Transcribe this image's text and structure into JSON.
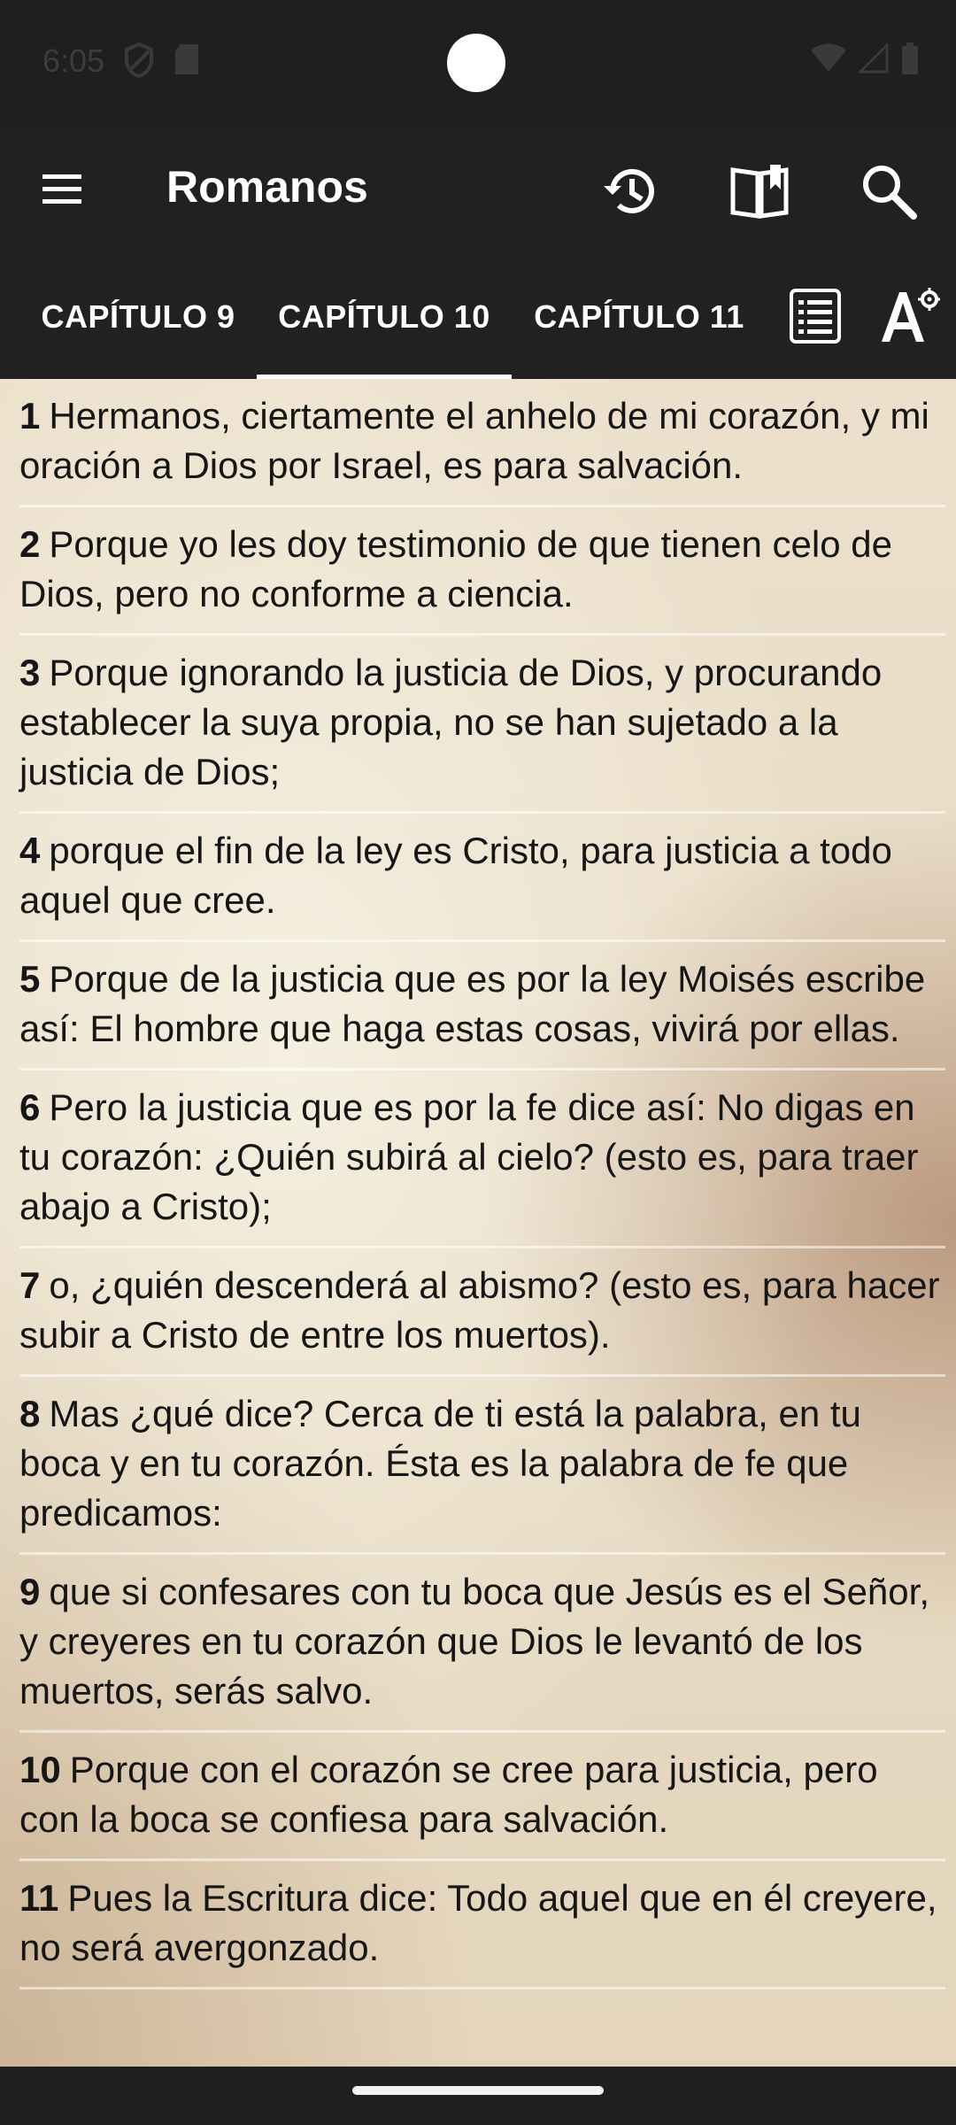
{
  "status_bar": {
    "time": "6:05",
    "icons": [
      "shield-icon",
      "sd-card-icon",
      "wifi-icon",
      "signal-icon",
      "battery-icon"
    ]
  },
  "toolbar": {
    "title": "Romanos",
    "icons": [
      "menu-icon",
      "history-icon",
      "book-icon",
      "search-icon"
    ]
  },
  "tabs": [
    {
      "label": "CAPÍTULO 9",
      "active": false
    },
    {
      "label": "CAPÍTULO 10",
      "active": true
    },
    {
      "label": "CAPÍTULO 11",
      "active": false
    }
  ],
  "tab_actions": [
    "list-icon",
    "font-settings-icon"
  ],
  "verses": [
    {
      "num": "1",
      "text": "Hermanos, ciertamente el anhelo de mi corazón, y mi oración a Dios por Israel, es para salvación."
    },
    {
      "num": "2",
      "text": "Porque yo les doy testimonio de que tienen celo de Dios, pero no conforme a ciencia."
    },
    {
      "num": "3",
      "text": "Porque ignorando la justicia de Dios, y procurando establecer la suya propia, no se han sujetado a la justicia de Dios;"
    },
    {
      "num": "4",
      "text": "porque el fin de la ley es Cristo, para justicia a todo aquel que cree."
    },
    {
      "num": "5",
      "text": "Porque de la justicia que es por la ley Moisés escribe así: El hombre que haga estas cosas, vivirá por ellas."
    },
    {
      "num": "6",
      "text": "Pero la justicia que es por la fe dice así: No digas en tu corazón: ¿Quién subirá al cielo? (esto es, para traer abajo a Cristo);"
    },
    {
      "num": "7",
      "text": "o, ¿quién descenderá al abismo? (esto es, para hacer subir a Cristo de entre los muertos)."
    },
    {
      "num": "8",
      "text": "Mas ¿qué dice? Cerca de ti está la palabra, en tu boca y en tu corazón. Ésta es la palabra de fe que predicamos:"
    },
    {
      "num": "9",
      "text": "que si confesares con tu boca que Jesús es el Señor, y creyeres en tu corazón que Dios le levantó de los muertos, serás salvo."
    },
    {
      "num": "10",
      "text": "Porque con el corazón se cree para justicia, pero con la boca se confiesa para salvación."
    },
    {
      "num": "11",
      "text": "Pues la Escritura dice: Todo aquel que en él creyere, no será avergonzado."
    }
  ]
}
